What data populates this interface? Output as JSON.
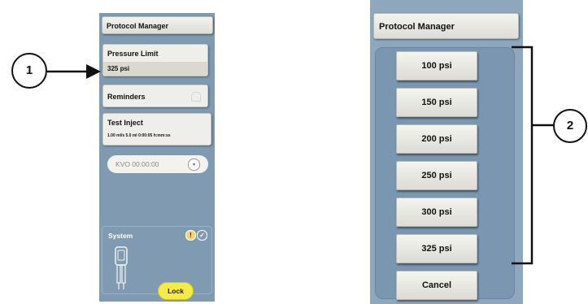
{
  "left_panel": {
    "title": "Protocol Manager",
    "pressure_limit": {
      "label": "Pressure Limit",
      "value": "325 psi"
    },
    "reminders": {
      "label": "Reminders"
    },
    "test_inject": {
      "label": "Test Inject",
      "value": "1.00 ml/s 5.0 ml 0:00:05 h:mm:ss"
    },
    "kvo": {
      "label": "KVO 00:00:00"
    },
    "system": {
      "label": "System",
      "lock_label": "Lock"
    }
  },
  "right_panel": {
    "title": "Protocol Manager",
    "options": [
      "100 psi",
      "150 psi",
      "200 psi",
      "250 psi",
      "300 psi",
      "325 psi"
    ],
    "cancel_label": "Cancel"
  },
  "callouts": {
    "one": "1",
    "two": "2"
  },
  "colors": {
    "panel_bg": "#7f9ab1",
    "lock_button": "#f6e94a",
    "button_face": "#eeeeea"
  }
}
